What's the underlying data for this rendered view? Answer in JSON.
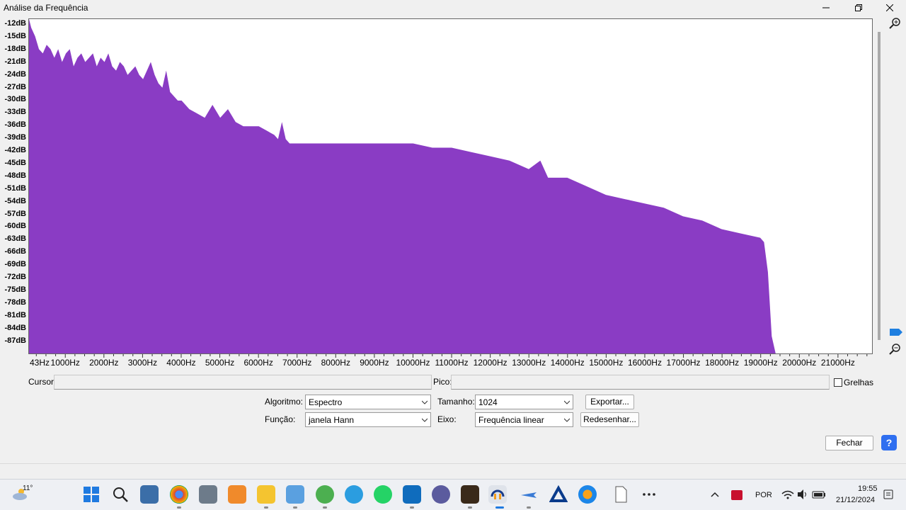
{
  "window": {
    "title": "Análise da Frequência"
  },
  "y_ticks": [
    "-12dB",
    "-15dB",
    "-18dB",
    "-21dB",
    "-24dB",
    "-27dB",
    "-30dB",
    "-33dB",
    "-36dB",
    "-39dB",
    "-42dB",
    "-45dB",
    "-48dB",
    "-51dB",
    "-54dB",
    "-57dB",
    "-60dB",
    "-63dB",
    "-66dB",
    "-69dB",
    "-72dB",
    "-75dB",
    "-78dB",
    "-81dB",
    "-84dB",
    "-87dB"
  ],
  "x_ticks": [
    "43Hz",
    "1000Hz",
    "2000Hz",
    "3000Hz",
    "4000Hz",
    "5000Hz",
    "6000Hz",
    "7000Hz",
    "8000Hz",
    "9000Hz",
    "10000Hz",
    "11000Hz",
    "12000Hz",
    "13000Hz",
    "14000Hz",
    "15000Hz",
    "16000Hz",
    "17000Hz",
    "18000Hz",
    "19000Hz",
    "20000Hz",
    "21000Hz"
  ],
  "chart_data": {
    "type": "area",
    "xlabel": "",
    "ylabel": "",
    "xlim": [
      43,
      21900
    ],
    "ylim": [
      -89,
      -11
    ],
    "grid": false,
    "series_color": "#8a3cc4",
    "x": [
      43,
      100,
      200,
      300,
      400,
      500,
      600,
      700,
      800,
      900,
      1000,
      1100,
      1200,
      1300,
      1400,
      1500,
      1600,
      1700,
      1800,
      1900,
      2000,
      2100,
      2200,
      2300,
      2400,
      2500,
      2600,
      2700,
      2800,
      2900,
      3000,
      3100,
      3200,
      3300,
      3400,
      3500,
      3600,
      3700,
      3800,
      3900,
      4000,
      4200,
      4400,
      4600,
      4800,
      5000,
      5200,
      5400,
      5600,
      5800,
      6000,
      6200,
      6400,
      6500,
      6600,
      6700,
      6800,
      7000,
      7500,
      8000,
      8500,
      9000,
      9500,
      10000,
      10500,
      11000,
      11500,
      12000,
      12500,
      13000,
      13300,
      13500,
      14000,
      14500,
      15000,
      15500,
      16000,
      16500,
      17000,
      17500,
      18000,
      18500,
      19000,
      19100,
      19200,
      19300,
      19400
    ],
    "y": [
      -11,
      -13,
      -15,
      -18,
      -19,
      -17,
      -18,
      -20,
      -18,
      -21,
      -19,
      -18,
      -22,
      -20,
      -19,
      -21,
      -20,
      -19,
      -22,
      -20,
      -21,
      -19,
      -22,
      -23,
      -21,
      -22,
      -24,
      -23,
      -22,
      -24,
      -25,
      -23,
      -21,
      -24,
      -26,
      -27,
      -23,
      -28,
      -29,
      -30,
      -30,
      -32,
      -33,
      -34,
      -31,
      -34,
      -32,
      -35,
      -36,
      -36,
      -36,
      -37,
      -38,
      -39,
      -35,
      -39,
      -40,
      -40,
      -40,
      -40,
      -40,
      -40,
      -40,
      -40,
      -41,
      -41,
      -42,
      -43,
      -44,
      -46,
      -44,
      -48,
      -48,
      -50,
      -52,
      -53,
      -54,
      -55,
      -57,
      -58,
      -60,
      -61,
      -62,
      -63,
      -70,
      -85,
      -89
    ]
  },
  "cursor_label": "Cursor:",
  "peak_label": "Pico:",
  "grid_label": "Grelhas",
  "algorithm": {
    "label": "Algoritmo:",
    "value": "Espectro"
  },
  "function": {
    "label": "Função:",
    "value": "janela Hann"
  },
  "size": {
    "label": "Tamanho:",
    "value": "1024"
  },
  "axis": {
    "label": "Eixo:",
    "value": "Frequência linear"
  },
  "buttons": {
    "export": "Exportar...",
    "redraw": "Redesenhar...",
    "close": "Fechar",
    "help": "?"
  },
  "taskbar": {
    "weather_temp": "11°",
    "language": "POR",
    "time": "19:55",
    "date": "21/12/2024"
  }
}
